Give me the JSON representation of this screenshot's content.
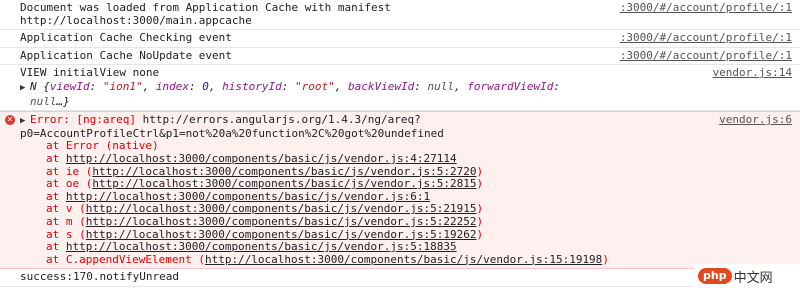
{
  "messages": [
    {
      "text": "Document was loaded from Application Cache with manifest\nhttp://localhost:3000/main.appcache",
      "source": ":3000/#/account/profile/:1"
    },
    {
      "text": "Application Cache Checking event",
      "source": ":3000/#/account/profile/:1"
    },
    {
      "text": "Application Cache NoUpdate event",
      "source": ":3000/#/account/profile/:1"
    }
  ],
  "view_log": {
    "text": "VIEW initialView none",
    "source": "vendor.js:14",
    "obj_prefix": "N {",
    "k1": "viewId",
    "v1": "\"ion1\"",
    "k2": "index",
    "v2": "0",
    "k3": "historyId",
    "v3": "\"root\"",
    "k4": "backViewId",
    "v4": "null",
    "k5": "forwardViewId",
    "v5": "null",
    "obj_suffix": "…}"
  },
  "error": {
    "head": "Error: [ng:areq] ",
    "url": "http://errors.angularjs.org/1.4.3/ng/areq?",
    "url2": "p0=AccountProfileCtrl&p1=not%20a%20function%2C%20got%20undefined",
    "source": "vendor.js:6",
    "stack": [
      {
        "prefix": "at Error (native)",
        "link": "",
        "paren": false
      },
      {
        "prefix": "at ",
        "link": "http://localhost:3000/components/basic/js/vendor.js:4:27114",
        "paren": false
      },
      {
        "prefix": "at ie (",
        "link": "http://localhost:3000/components/basic/js/vendor.js:5:2720",
        "paren": true
      },
      {
        "prefix": "at oe (",
        "link": "http://localhost:3000/components/basic/js/vendor.js:5:2815",
        "paren": true
      },
      {
        "prefix": "at ",
        "link": "http://localhost:3000/components/basic/js/vendor.js:6:1",
        "paren": false
      },
      {
        "prefix": "at v (",
        "link": "http://localhost:3000/components/basic/js/vendor.js:5:21915",
        "paren": true
      },
      {
        "prefix": "at m (",
        "link": "http://localhost:3000/components/basic/js/vendor.js:5:22252",
        "paren": true
      },
      {
        "prefix": "at s (",
        "link": "http://localhost:3000/components/basic/js/vendor.js:5:19262",
        "paren": true
      },
      {
        "prefix": "at ",
        "link": "http://localhost:3000/components/basic/js/vendor.js:5:18835",
        "paren": false
      },
      {
        "prefix": "at C.appendViewElement (",
        "link": "http://localhost:3000/components/basic/js/vendor.js:15:19198",
        "paren": true
      }
    ]
  },
  "last_line": "success:170.notifyUnread",
  "watermark": {
    "logo": "php",
    "text": "中文网"
  }
}
